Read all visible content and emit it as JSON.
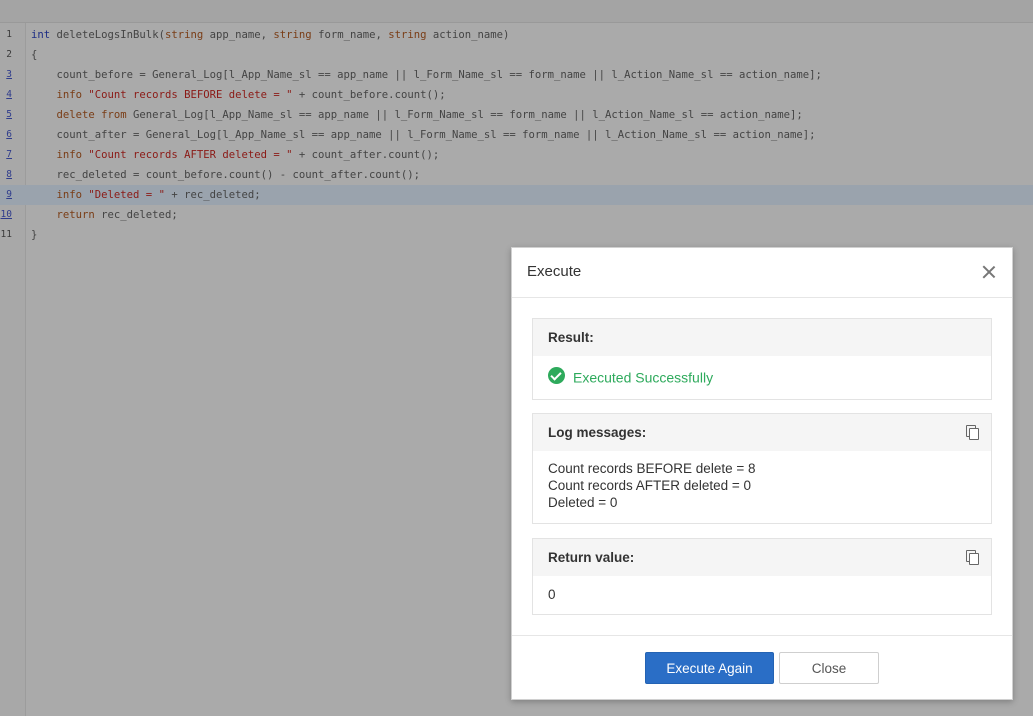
{
  "editor": {
    "lines": [
      {
        "num": "1",
        "link": false,
        "parts": [
          [
            "kw",
            "int"
          ],
          [
            "fn",
            " deleteLogsInBulk("
          ],
          [
            "ty",
            "string"
          ],
          [
            "fn",
            " app_name, "
          ],
          [
            "ty",
            "string"
          ],
          [
            "fn",
            " form_name, "
          ],
          [
            "ty",
            "string"
          ],
          [
            "fn",
            " action_name)"
          ]
        ]
      },
      {
        "num": "2",
        "link": false,
        "parts": [
          [
            "fn",
            "{"
          ]
        ]
      },
      {
        "num": "3",
        "link": true,
        "parts": [
          [
            "fn",
            "    count_before = General_Log[l_App_Name_sl == app_name || l_Form_Name_sl == form_name || l_Action_Name_sl == action_name];"
          ]
        ]
      },
      {
        "num": "4",
        "link": true,
        "parts": [
          [
            "ty",
            "    info "
          ],
          [
            "str",
            "\"Count records BEFORE delete = \""
          ],
          [
            "fn",
            " + count_before.count();"
          ]
        ]
      },
      {
        "num": "5",
        "link": true,
        "parts": [
          [
            "ty",
            "    delete from"
          ],
          [
            "fn",
            " General_Log[l_App_Name_sl == app_name || l_Form_Name_sl == form_name || l_Action_Name_sl == action_name];"
          ]
        ]
      },
      {
        "num": "6",
        "link": true,
        "parts": [
          [
            "fn",
            "    count_after = General_Log[l_App_Name_sl == app_name || l_Form_Name_sl == form_name || l_Action_Name_sl == action_name];"
          ]
        ]
      },
      {
        "num": "7",
        "link": true,
        "parts": [
          [
            "ty",
            "    info "
          ],
          [
            "str",
            "\"Count records AFTER deleted = \""
          ],
          [
            "fn",
            " + count_after.count();"
          ]
        ]
      },
      {
        "num": "8",
        "link": true,
        "parts": [
          [
            "fn",
            "    rec_deleted = count_before.count() - count_after.count();"
          ]
        ]
      },
      {
        "num": "9",
        "link": true,
        "active": true,
        "parts": [
          [
            "ty",
            "    info "
          ],
          [
            "str",
            "\"Deleted = \""
          ],
          [
            "fn",
            " + rec_deleted;"
          ]
        ]
      },
      {
        "num": "10",
        "link": true,
        "parts": [
          [
            "ty",
            "    return"
          ],
          [
            "fn",
            " rec_deleted;"
          ]
        ]
      },
      {
        "num": "11",
        "link": false,
        "parts": [
          [
            "fn",
            "}"
          ]
        ]
      }
    ]
  },
  "dialog": {
    "title": "Execute",
    "result_label": "Result:",
    "result_text": "Executed Successfully",
    "log_label": "Log messages:",
    "log_lines": [
      "Count records BEFORE delete = 8",
      "Count records AFTER deleted = 0",
      "Deleted = 0"
    ],
    "return_label": "Return value:",
    "return_value": "0",
    "execute_again_label": "Execute Again",
    "close_label": "Close"
  },
  "colors": {
    "success": "#2eaa5c",
    "primary": "#2a6ec6"
  }
}
